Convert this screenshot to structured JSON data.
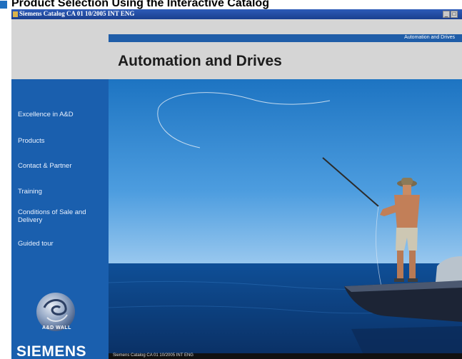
{
  "doc_heading": {
    "text": "Product Selection Using the Interactive Catalog",
    "marker_color": "#1f6fbf"
  },
  "window": {
    "title": "Siemens Catalog CA 01 10/2005 INT ENG",
    "controls": [
      "minimize-icon",
      "restore-icon"
    ]
  },
  "header": {
    "crumb": "Automation and Drives",
    "title": "Automation and Drives",
    "accent_color": "#1f5da8"
  },
  "sidebar": {
    "background_color": "#1a5fae",
    "items": [
      {
        "label": "Excellence in A&D"
      },
      {
        "label": "Products"
      },
      {
        "label": "Contact & Partner"
      },
      {
        "label": "Training"
      },
      {
        "label": "Conditions of Sale and Delivery"
      },
      {
        "label": "Guided tour"
      }
    ],
    "logo_label": "A&D WALL",
    "brand": "SIEMENS"
  },
  "status_bar": {
    "text": "Siemens Catalog CA 01 10/2005 INT ENG"
  }
}
